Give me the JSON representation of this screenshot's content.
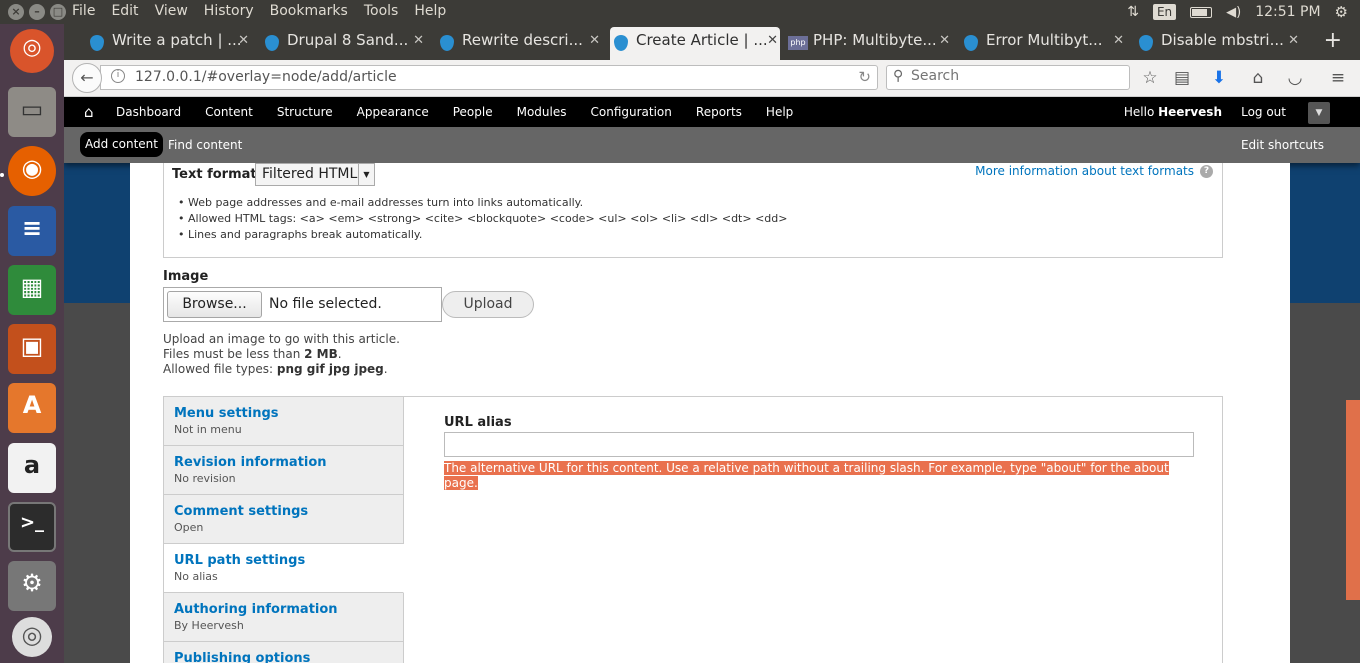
{
  "system": {
    "menu": [
      "File",
      "Edit",
      "View",
      "History",
      "Bookmarks",
      "Tools",
      "Help"
    ],
    "lang": "En",
    "clock": "12:51 PM"
  },
  "tabs": [
    {
      "label": "Write a patch | ...",
      "icon": "drupal-icon"
    },
    {
      "label": "Drupal 8 Sand...",
      "icon": "drupal-icon"
    },
    {
      "label": "Rewrite descri...",
      "icon": "drupal-icon"
    },
    {
      "label": "Create Article | ...",
      "icon": "drupal-icon",
      "active": true
    },
    {
      "label": "PHP: Multibyte...",
      "icon": "php-icon"
    },
    {
      "label": "Error Multibyt...",
      "icon": "drupal-icon"
    },
    {
      "label": "Disable mbstri...",
      "icon": "drupal-icon"
    }
  ],
  "nav": {
    "url": "127.0.0.1/#overlay=node/add/article",
    "search_placeholder": "Search"
  },
  "admin": {
    "items": [
      "Dashboard",
      "Content",
      "Structure",
      "Appearance",
      "People",
      "Modules",
      "Configuration",
      "Reports",
      "Help"
    ],
    "hello_prefix": "Hello ",
    "user": "Heervesh",
    "logout": "Log out"
  },
  "shortcuts": {
    "add": "Add content",
    "find": "Find content",
    "edit": "Edit shortcuts"
  },
  "text_format": {
    "label": "Text format",
    "selected": "Filtered HTML",
    "more_info": "More information about text formats",
    "tips": [
      "Web page addresses and e-mail addresses turn into links automatically.",
      "Allowed HTML tags: <a> <em> <strong> <cite> <blockquote> <code> <ul> <ol> <li> <dl> <dt> <dd>",
      "Lines and paragraphs break automatically."
    ]
  },
  "image": {
    "label": "Image",
    "browse": "Browse...",
    "no_file": "No file selected.",
    "upload": "Upload",
    "help1": "Upload an image to go with this article.",
    "help2_prefix": "Files must be less than ",
    "help2_value": "2 MB",
    "help2_suffix": ".",
    "help3_prefix": "Allowed file types: ",
    "help3_value": "png gif jpg jpeg",
    "help3_suffix": "."
  },
  "vtabs": [
    {
      "title": "Menu settings",
      "summary": "Not in menu"
    },
    {
      "title": "Revision information",
      "summary": "No revision"
    },
    {
      "title": "Comment settings",
      "summary": "Open"
    },
    {
      "title": "URL path settings",
      "summary": "No alias",
      "selected": true
    },
    {
      "title": "Authoring information",
      "summary": "By Heervesh"
    },
    {
      "title": "Publishing options",
      "summary": ""
    }
  ],
  "url_alias": {
    "label": "URL alias",
    "value": "",
    "help": "The alternative URL for this content. Use a relative path without a trailing slash. For example, type \"about\" for the about page."
  },
  "colors": {
    "admin_bar": "#000000",
    "link": "#0074bd",
    "highlight": "#e9714e",
    "launcher": "#4d3c4a"
  }
}
